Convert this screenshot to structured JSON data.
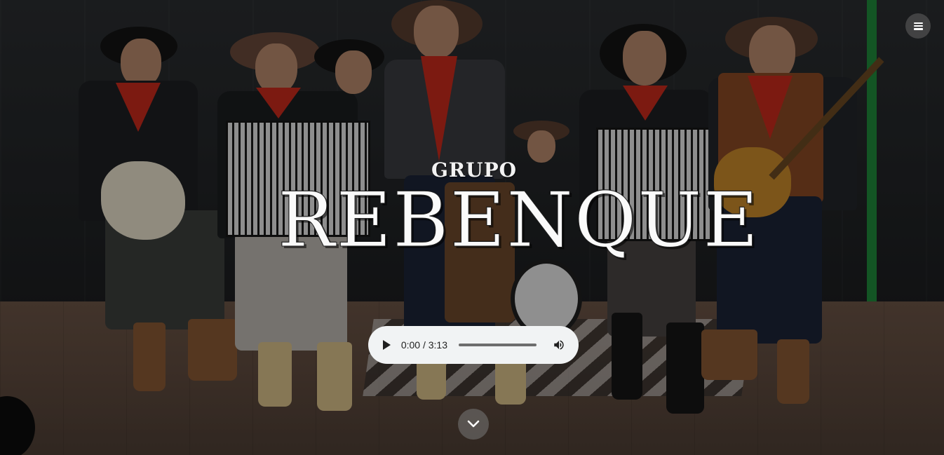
{
  "hero": {
    "logo_small": "GRUPO",
    "logo_big": "REBENQUE",
    "background_photo_alt": "band photo"
  },
  "header": {
    "menu_icon": "hamburger-menu-icon"
  },
  "audio_player": {
    "time_display": "0:00 / 3:13",
    "current": "0:00",
    "duration": "3:13",
    "progress": 0,
    "play_icon": "play-icon",
    "volume_icon": "volume-icon"
  },
  "scroll": {
    "icon": "chevron-down-icon"
  },
  "colors": {
    "player_bg": "#f1f3f4",
    "logo_text": "#fafafa",
    "scarf_red": "#c92a1c",
    "wall_green": "#1f8a3a"
  }
}
